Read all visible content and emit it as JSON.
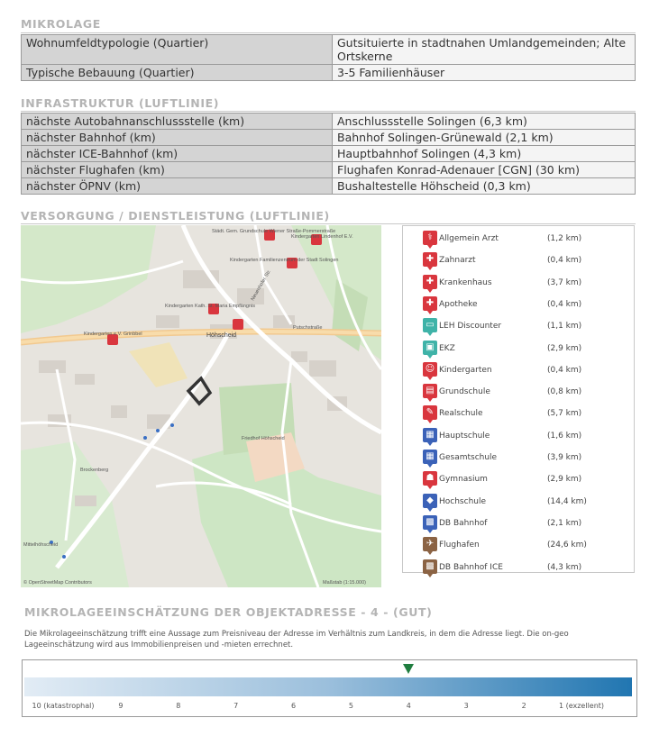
{
  "mikrolage": {
    "title": "MIKROLAGE",
    "rows": [
      {
        "key": "Wohnumfeldtypologie (Quartier)",
        "value": "Gutsituierte in stadtnahen Umlandgemeinden; Alte Ortskerne"
      },
      {
        "key": "Typische Bebauung (Quartier)",
        "value": "3-5 Familienhäuser"
      }
    ]
  },
  "infrastruktur": {
    "title": "INFRASTRUKTUR (LUFTLINIE)",
    "rows": [
      {
        "key": "nächste Autobahnanschlussstelle (km)",
        "value": "Anschlussstelle Solingen (6,3 km)"
      },
      {
        "key": "nächster Bahnhof (km)",
        "value": "Bahnhof Solingen-Grünewald (2,1 km)"
      },
      {
        "key": "nächster ICE-Bahnhof (km)",
        "value": "Hauptbahnhof Solingen (4,3 km)"
      },
      {
        "key": "nächster Flughafen (km)",
        "value": "Flughafen Konrad-Adenauer [CGN] (30 km)"
      },
      {
        "key": "nächster ÖPNV (km)",
        "value": "Bushaltestelle Höhscheid (0,3 km)"
      }
    ]
  },
  "versorgung": {
    "title": "VERSORGUNG / DIENSTLEISTUNG (LUFTLINIE)",
    "legend": [
      {
        "label": "Allgemein Arzt",
        "distance": "(1,2 km)",
        "icon": "doctor-icon",
        "glyph": "⚕",
        "color": "#d9363e"
      },
      {
        "label": "Zahnarzt",
        "distance": "(0,4 km)",
        "icon": "dentist-icon",
        "glyph": "✚",
        "color": "#d9363e"
      },
      {
        "label": "Krankenhaus",
        "distance": "(3,7 km)",
        "icon": "hospital-icon",
        "glyph": "✚",
        "color": "#d9363e"
      },
      {
        "label": "Apotheke",
        "distance": "(0,4 km)",
        "icon": "pharmacy-icon",
        "glyph": "✚",
        "color": "#d9363e"
      },
      {
        "label": "LEH Discounter",
        "distance": "(1,1 km)",
        "icon": "discounter-icon",
        "glyph": "▭",
        "color": "#3fb3a8"
      },
      {
        "label": "EKZ",
        "distance": "(2,9 km)",
        "icon": "shopping-center-icon",
        "glyph": "▣",
        "color": "#3fb3a8"
      },
      {
        "label": "Kindergarten",
        "distance": "(0,4 km)",
        "icon": "kindergarten-icon",
        "glyph": "☺",
        "color": "#d9363e"
      },
      {
        "label": "Grundschule",
        "distance": "(0,8 km)",
        "icon": "primary-school-icon",
        "glyph": "▤",
        "color": "#d9363e"
      },
      {
        "label": "Realschule",
        "distance": "(5,7 km)",
        "icon": "realschule-icon",
        "glyph": "✎",
        "color": "#d9363e"
      },
      {
        "label": "Hauptschule",
        "distance": "(1,6 km)",
        "icon": "hauptschule-icon",
        "glyph": "▦",
        "color": "#3b62b8"
      },
      {
        "label": "Gesamtschule",
        "distance": "(3,9 km)",
        "icon": "gesamtschule-icon",
        "glyph": "▦",
        "color": "#3b62b8"
      },
      {
        "label": "Gymnasium",
        "distance": "(2,9 km)",
        "icon": "gymnasium-icon",
        "glyph": "☗",
        "color": "#d9363e"
      },
      {
        "label": "Hochschule",
        "distance": "(14,4 km)",
        "icon": "university-icon",
        "glyph": "◆",
        "color": "#3b62b8"
      },
      {
        "label": "DB Bahnhof",
        "distance": "(2,1 km)",
        "icon": "train-station-icon",
        "glyph": "▩",
        "color": "#3b62b8"
      },
      {
        "label": "Flughafen",
        "distance": "(24,6 km)",
        "icon": "airport-icon",
        "glyph": "✈",
        "color": "#8b6344"
      },
      {
        "label": "DB Bahnhof ICE",
        "distance": "(4,3 km)",
        "icon": "ice-station-icon",
        "glyph": "▩",
        "color": "#8b6344"
      }
    ]
  },
  "map": {
    "labels": {
      "school_top": "Städt. Gem. Grundschule Wiener Straße-Pommerstraße",
      "kita_top": "Kindergarten Lindenhof E.V.",
      "kita_famz": "Kindergarten Familienzentrum der Stadt Solingen",
      "kita_kath": "Kindergarten Kath. St. Maria Empfängnis",
      "kita_left": "Kindergarten e.V. Grinbbel",
      "town": "Höhscheid",
      "street_putsch": "Putschstraße",
      "street_neustr": "Neuenhofer Str.",
      "place_brockenberg": "Brockenberg",
      "place_mittelhoehscheid": "Mittelhöhscheid",
      "place_friedhof": "Friedhof Höhscheid",
      "attribution": "© OpenStreetMap Contributors",
      "scale": "Maßstab (1:15.000)"
    }
  },
  "assessment": {
    "title": "MIKROLAGEEINSCHÄTZUNG DER OBJEKTADRESSE - 4 - (GUT)",
    "text": "Die Mikrolageeinschätzung trifft eine Aussage zum Preisniveau der Adresse im Verhältnis zum Landkreis, in dem die Adresse liegt. Die on-geo Lageeinschätzung wird aus Immobilienpreisen und -mieten errechnet.",
    "scale_labels": [
      "10 (katastrophal)",
      "9",
      "8",
      "7",
      "6",
      "5",
      "4",
      "3",
      "2",
      "1 (exzellent)"
    ],
    "selected_value": 4,
    "marker_color": "#1f7d3f"
  }
}
